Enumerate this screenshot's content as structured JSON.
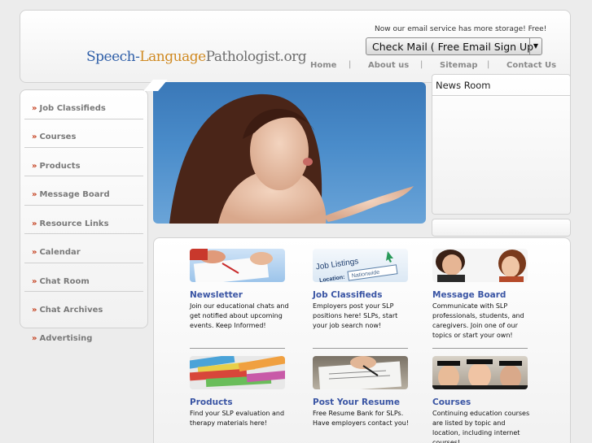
{
  "header": {
    "logo": {
      "part1": "Speech-",
      "part2": "Language",
      "part3": "Pathologist.org"
    },
    "promo_text": "Now our email service has more storage! Free!",
    "email_select": {
      "selected": "Check Mail ( Free Email Sign Up"
    },
    "top_links": [
      "Home",
      "About us",
      "Sitemap",
      "Contact Us"
    ],
    "separator": "|"
  },
  "sidebar": {
    "bullet": "»",
    "items": [
      "Job Classifieds",
      "Courses",
      "Products",
      "Message Board",
      "Resource Links",
      "Calendar",
      "Chat Room",
      "Chat Archives",
      "Advertising"
    ]
  },
  "news": {
    "title": "News Room"
  },
  "features": [
    {
      "title": "Newsletter",
      "desc": "Join our educational chats and get notified about upcoming events. Keep Informed!",
      "thumb": "newsletter-image"
    },
    {
      "title": "Job Classifieds",
      "desc": "Employers post your SLP positions here! SLPs, start your job search now!",
      "thumb": "job-listings-image",
      "thumb_text": {
        "heading": "Job Listings",
        "label": "Location:",
        "field": "Nationwide"
      }
    },
    {
      "title": "Message Board",
      "desc": "Communicate with SLP professionals, students, and caregivers. Join one of our topics or start your own!",
      "thumb": "message-board-image"
    },
    {
      "title": "Products",
      "desc": "Find your SLP evaluation and therapy materials here!",
      "thumb": "products-image"
    },
    {
      "title": "Post Your Resume",
      "desc": "Free Resume Bank for SLPs. Have employers contact you!",
      "thumb": "resume-image"
    },
    {
      "title": "Courses",
      "desc": "Continuing education courses are listed by topic and location, including internet courses!",
      "thumb": "courses-image"
    }
  ],
  "colors": {
    "accent_link": "#3a55a4",
    "bullet": "#c33c1a",
    "logo_blue": "#2f5fa8",
    "logo_orange": "#d08a22"
  }
}
